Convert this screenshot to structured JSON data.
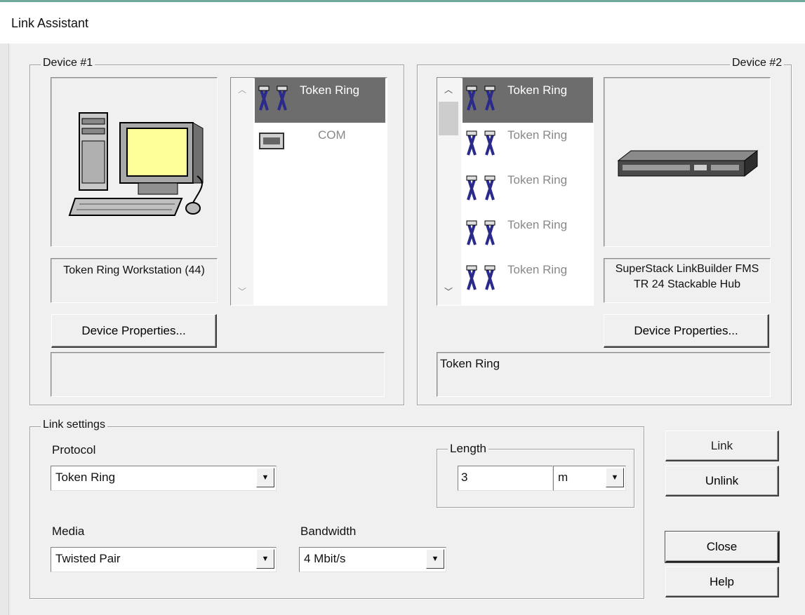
{
  "window": {
    "title": "Link Assistant"
  },
  "device1": {
    "legend": "Device #1",
    "name": "Token Ring Workstation (44)",
    "properties_button": "Device Properties...",
    "status": "",
    "ports": [
      {
        "label": "Token Ring",
        "icon": "token-ring-icon",
        "selected": true
      },
      {
        "label": "COM",
        "icon": "com-port-icon",
        "selected": false
      }
    ]
  },
  "device2": {
    "legend": "Device #2",
    "name": "SuperStack LinkBuilder FMS TR 24 Stackable Hub",
    "properties_button": "Device Properties...",
    "status": "Token Ring",
    "ports": [
      {
        "label": "Token Ring",
        "icon": "token-ring-icon",
        "selected": true
      },
      {
        "label": "Token Ring",
        "icon": "token-ring-icon",
        "selected": false
      },
      {
        "label": "Token Ring",
        "icon": "token-ring-icon",
        "selected": false
      },
      {
        "label": "Token Ring",
        "icon": "token-ring-icon",
        "selected": false
      },
      {
        "label": "Token Ring",
        "icon": "token-ring-icon",
        "selected": false
      }
    ]
  },
  "link_settings": {
    "legend": "Link settings",
    "protocol_label": "Protocol",
    "protocol_value": "Token Ring",
    "media_label": "Media",
    "media_value": "Twisted Pair",
    "bandwidth_label": "Bandwidth",
    "bandwidth_value": "4 Mbit/s",
    "length_legend": "Length",
    "length_value": "3",
    "length_unit": "m"
  },
  "buttons": {
    "link": "Link",
    "unlink": "Unlink",
    "close": "Close",
    "help": "Help"
  },
  "colors": {
    "selection": "#6d6d6d",
    "monitor_screen": "#ffff99",
    "port_icon": "#2a2a8a"
  }
}
